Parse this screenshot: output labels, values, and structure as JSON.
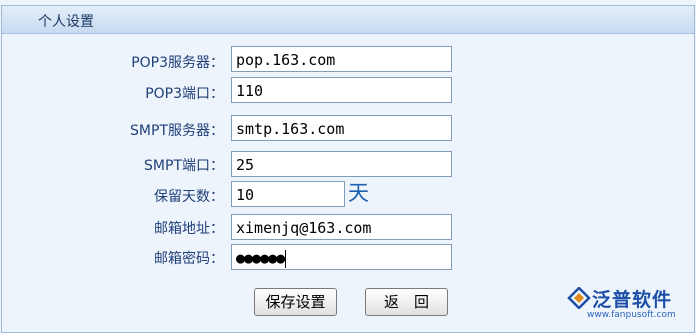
{
  "header": {
    "title": "个人设置"
  },
  "form": {
    "pop3_server": {
      "label": "POP3服务器：",
      "value": "pop.163.com"
    },
    "pop3_port": {
      "label": "POP3端口：",
      "value": "110"
    },
    "smtp_server": {
      "label": "SMPT服务器：",
      "value": "smtp.163.com"
    },
    "smtp_port": {
      "label": "SMPT端口：",
      "value": "25"
    },
    "keep_days": {
      "label": "保留天数：",
      "value": "10",
      "unit": "天"
    },
    "email": {
      "label": "邮箱地址：",
      "value": "ximenjq@163.com"
    },
    "password": {
      "label": "邮箱密码：",
      "value": "●●●●●●"
    }
  },
  "buttons": {
    "save": "保存设置",
    "back": "返　回"
  },
  "logo": {
    "name": "泛普软件",
    "url": "www.fanpusoft.com"
  },
  "colors": {
    "label": "#1f3f7a",
    "header_bg": "#c7daf0",
    "panel_bg": "#eef4fb",
    "accent": "#1f5fb0"
  }
}
